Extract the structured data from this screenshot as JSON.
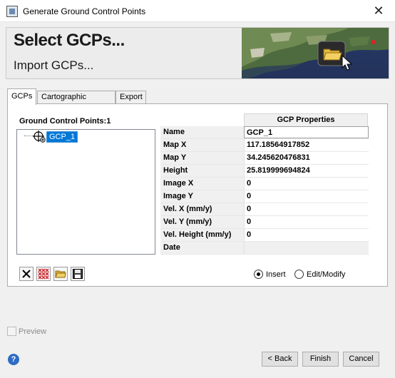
{
  "window": {
    "title": "Generate Ground Control Points",
    "close_glyph": "✕"
  },
  "banner": {
    "heading": "Select GCPs...",
    "subheading": "Import GCPs..."
  },
  "tabs": [
    {
      "label": "GCPs",
      "active": true
    },
    {
      "label": "Cartographic System",
      "active": false
    },
    {
      "label": "Export",
      "active": false
    }
  ],
  "gcp_panel": {
    "title": "Ground Control Points:",
    "count": "1",
    "tree_items": [
      {
        "label": "GCP_1",
        "selected": true
      }
    ]
  },
  "properties": {
    "header": "GCP Properties",
    "rows": [
      {
        "label": "Name",
        "value": "GCP_1"
      },
      {
        "label": "Map X",
        "value": "117.18564917852"
      },
      {
        "label": "Map Y",
        "value": "34.245620476831"
      },
      {
        "label": "Height",
        "value": "25.819999694824"
      },
      {
        "label": "Image X",
        "value": "0"
      },
      {
        "label": "Image Y",
        "value": "0"
      },
      {
        "label": "Vel. X (mm/y)",
        "value": "0"
      },
      {
        "label": "Vel. Y (mm/y)",
        "value": "0"
      },
      {
        "label": "Vel. Height (mm/y)",
        "value": "0"
      },
      {
        "label": "Date",
        "value": ""
      }
    ]
  },
  "toolbar": {
    "icons": [
      "delete-icon",
      "delete-all-icon",
      "open-folder-icon",
      "save-icon"
    ]
  },
  "mode": {
    "insert_label": "Insert",
    "edit_label": "Edit/Modify",
    "selected": "Insert"
  },
  "preview": {
    "label": "Preview",
    "checked": false,
    "enabled": false
  },
  "help": {
    "glyph": "?"
  },
  "buttons": {
    "back": "< Back",
    "finish": "Finish",
    "cancel": "Cancel"
  },
  "colors": {
    "selection": "#0078d7",
    "help": "#2f6cc4"
  }
}
